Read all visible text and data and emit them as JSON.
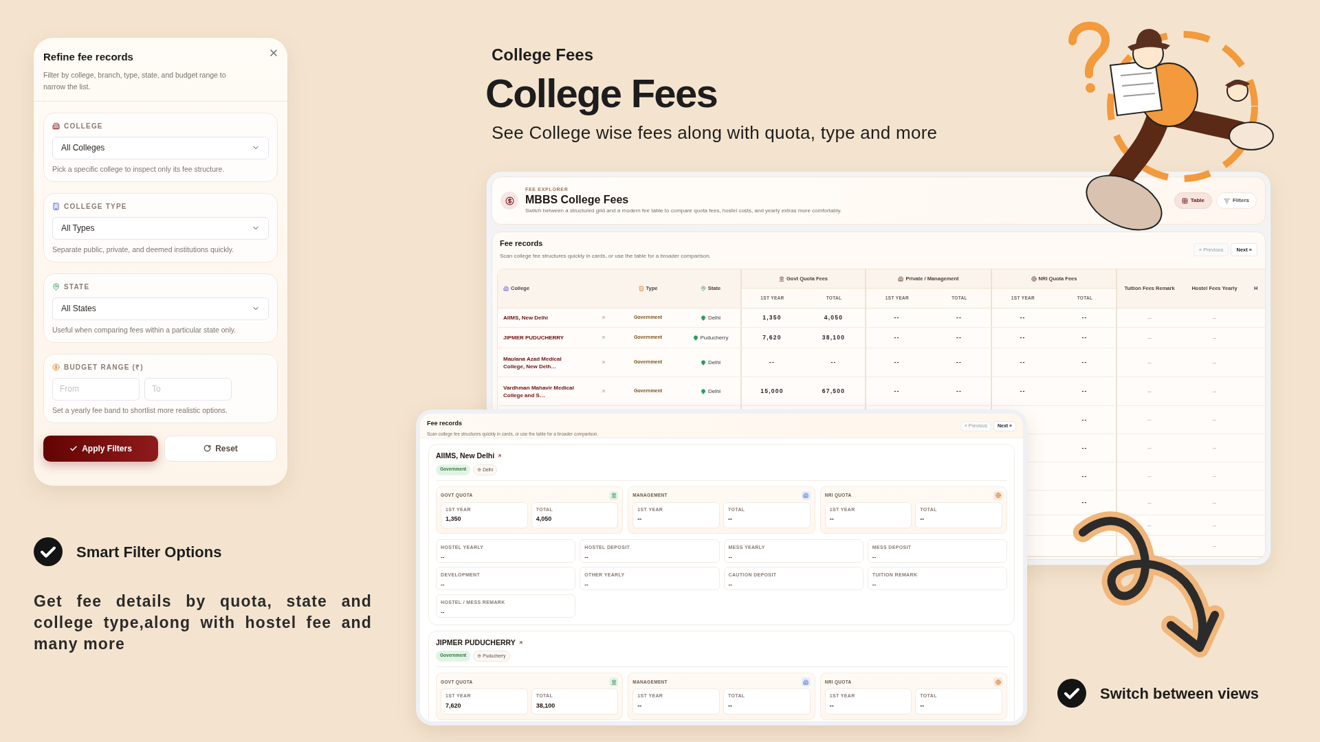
{
  "filter_panel": {
    "title": "Refine fee records",
    "description": "Filter by college, branch, type, state, and budget range to narrow the list.",
    "sections": [
      {
        "kind": "select",
        "label": "COLLEGE",
        "value": "All Colleges",
        "help": "Pick a specific college to inspect only its fee structure."
      },
      {
        "kind": "select",
        "label": "COLLEGE TYPE",
        "value": "All Types",
        "help": "Separate public, private, and deemed institutions quickly."
      },
      {
        "kind": "select",
        "label": "STATE",
        "value": "All States",
        "help": "Useful when comparing fees within a particular state only."
      },
      {
        "kind": "range",
        "label": "BUDGET RANGE (₹)",
        "fields": [
          {
            "placeholder": "From"
          },
          {
            "placeholder": "To"
          }
        ],
        "help": "Set a yearly fee band to shortlist more realistic options."
      }
    ],
    "buttons": [
      {
        "kind": "primary",
        "label": "Apply Filters"
      },
      {
        "kind": "secondary",
        "label": "Reset"
      }
    ]
  },
  "features": [
    {
      "label": "Smart Filter Options"
    },
    {
      "label": "Switch between views"
    }
  ],
  "description": "Get fee details by quota, state and college type,along with hostel fee and many more",
  "hero": {
    "eyebrow": "College Fees",
    "title": "College Fees",
    "subtitle": "See College wise fees along with quota, type and more"
  },
  "table_view": {
    "eyebrow": "FEE EXPLORER",
    "title": "MBBS College Fees",
    "description": "Switch between a structured grid and a modern fee table to compare quota fees, hostel costs, and yearly extras more comfortably.",
    "view_buttons": [
      {
        "label": "Table",
        "selected": true
      },
      {
        "label": "Filters",
        "selected": false
      }
    ],
    "records": {
      "title": "Fee records",
      "description": "Scan college fee structures quickly in cards, or use the table for a broader comparison.",
      "pagination": [
        {
          "label": "« Previous",
          "disabled": true
        },
        {
          "label": "Next »",
          "disabled": false
        }
      ]
    },
    "table": {
      "columns": [
        {
          "label": "College"
        },
        {
          "label": "Type"
        },
        {
          "label": "State"
        },
        {
          "label": "Govt Quota Fees",
          "sub": [
            "1ST YEAR",
            "TOTAL"
          ]
        },
        {
          "label": "Private / Management",
          "sub": [
            "1ST YEAR",
            "TOTAL"
          ]
        },
        {
          "label": "NRI Quota Fees",
          "sub": [
            "1ST YEAR",
            "TOTAL"
          ]
        },
        {
          "label": "Tuition Fees Remark"
        },
        {
          "label": "Hostel Fees Yearly"
        },
        {
          "label": "H"
        }
      ],
      "rows": [
        {
          "kind": "record",
          "college": "AIIMS, New Delhi",
          "type": "Government",
          "state": "Delhi",
          "fees": [
            "1,350",
            "4,050",
            "--",
            "--",
            "--",
            "--"
          ],
          "remarks": [
            "--",
            "--"
          ]
        },
        {
          "kind": "record",
          "college": "JIPMER PUDUCHERRY",
          "type": "Government",
          "state": "Puducherry",
          "fees": [
            "7,620",
            "38,100",
            "--",
            "--",
            "--",
            "--"
          ],
          "remarks": [
            "--",
            "--"
          ]
        },
        {
          "kind": "record",
          "college": "Maulana Azad Medical College, New Delh…",
          "type": "Government",
          "state": "Delhi",
          "fees": [
            "--",
            "--",
            "--",
            "--",
            "--",
            "--"
          ],
          "remarks": [
            "--",
            "--"
          ]
        },
        {
          "kind": "record",
          "college": "Vardhman Mahavir Medical College and S…",
          "type": "Government",
          "state": "Delhi",
          "fees": [
            "15,000",
            "67,500",
            "--",
            "--",
            "--",
            "--"
          ],
          "remarks": [
            "--",
            "--"
          ]
        },
        {
          "kind": "tail",
          "cells": [
            "--",
            "--",
            "--"
          ]
        },
        {
          "kind": "tail",
          "cells": [
            "--",
            "--",
            "--"
          ]
        },
        {
          "kind": "tail",
          "cells": [
            "--",
            "--",
            "--"
          ]
        },
        {
          "kind": "tail",
          "cells": [
            "--",
            "--",
            "--"
          ]
        },
        {
          "kind": "tail",
          "cells": [
            "--",
            "--"
          ]
        },
        {
          "kind": "tail",
          "cells": [
            "--"
          ]
        }
      ]
    }
  },
  "card_view": {
    "records": {
      "title": "Fee records",
      "description": "Scan college fee structures quickly in cards, or use the table for a broader comparison.",
      "pagination": [
        {
          "label": "« Previous",
          "disabled": true
        },
        {
          "label": "Next »",
          "disabled": false
        }
      ]
    },
    "cards": [
      {
        "college": "AIIMS, New Delhi",
        "type": "Government",
        "state": "Delhi",
        "quotas": [
          {
            "label": "GOVT QUOTA",
            "values": [
              {
                "label": "1ST YEAR",
                "value": "1,350"
              },
              {
                "label": "TOTAL",
                "value": "4,050"
              }
            ]
          },
          {
            "label": "MANAGEMENT",
            "values": [
              {
                "label": "1ST YEAR",
                "value": "--"
              },
              {
                "label": "TOTAL",
                "value": "--"
              }
            ]
          },
          {
            "label": "NRI QUOTA",
            "values": [
              {
                "label": "1ST YEAR",
                "value": "--"
              },
              {
                "label": "TOTAL",
                "value": "--"
              }
            ]
          }
        ],
        "details": [
          {
            "label": "HOSTEL YEARLY",
            "value": "--"
          },
          {
            "label": "HOSTEL DEPOSIT",
            "value": "--"
          },
          {
            "label": "MESS YEARLY",
            "value": "--"
          },
          {
            "label": "MESS DEPOSIT",
            "value": "--"
          },
          {
            "label": "DEVELOPMENT",
            "value": "--"
          },
          {
            "label": "OTHER YEARLY",
            "value": "--"
          },
          {
            "label": "CAUTION DEPOSIT",
            "value": "--"
          },
          {
            "label": "TUITION REMARK",
            "value": "--"
          },
          {
            "label": "HOSTEL / MESS REMARK",
            "value": "--"
          }
        ]
      },
      {
        "college": "JIPMER PUDUCHERRY",
        "type": "Government",
        "state": "Puducherry",
        "quotas": [
          {
            "label": "GOVT QUOTA",
            "values": [
              {
                "label": "1ST YEAR",
                "value": "7,620"
              },
              {
                "label": "TOTAL",
                "value": "38,100"
              }
            ]
          },
          {
            "label": "MANAGEMENT",
            "values": [
              {
                "label": "1ST YEAR",
                "value": "--"
              },
              {
                "label": "TOTAL",
                "value": "--"
              }
            ]
          },
          {
            "label": "NRI QUOTA",
            "values": [
              {
                "label": "1ST YEAR",
                "value": "--"
              },
              {
                "label": "TOTAL",
                "value": "--"
              }
            ]
          }
        ]
      }
    ]
  }
}
